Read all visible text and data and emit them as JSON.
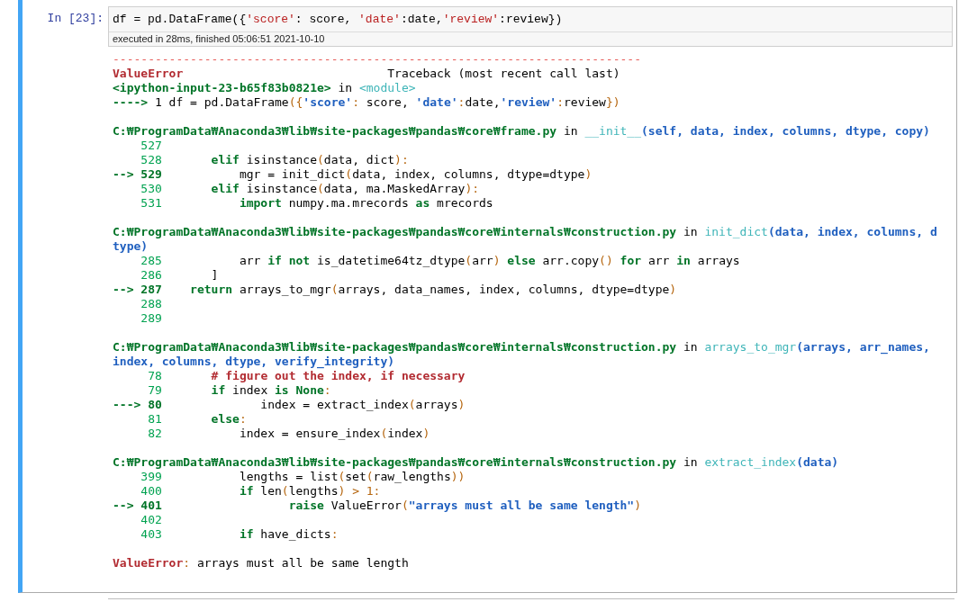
{
  "cell": {
    "prompt": "In [23]:",
    "selected": true,
    "input": [
      {
        "kind": "plain",
        "text": "df = pd.DataFrame({"
      },
      {
        "kind": "istr",
        "text": "'score'"
      },
      {
        "kind": "plain",
        "text": ": score, "
      },
      {
        "kind": "istr",
        "text": "'date'"
      },
      {
        "kind": "plain",
        "text": ":date,"
      },
      {
        "kind": "istr",
        "text": "'review'"
      },
      {
        "kind": "plain",
        "text": ":review})"
      }
    ],
    "execution_note": "executed in 28ms, finished 05:06:51 2021-10-10",
    "output": [
      {
        "lines": [
          [
            {
              "kind": "dash",
              "text": "---------------------------------------------------------------------------"
            }
          ],
          [
            {
              "kind": "error",
              "text": "ValueError"
            },
            {
              "kind": "plain",
              "text": "                             Traceback (most recent call last)"
            }
          ],
          [
            {
              "kind": "path",
              "text": "<ipython-input-23-b65f83b0821e>"
            },
            {
              "kind": "plain",
              "text": " in "
            },
            {
              "kind": "func",
              "text": "<module>"
            }
          ],
          [
            {
              "kind": "arrow",
              "text": "---->"
            },
            {
              "kind": "plain",
              "text": " 1 df = pd.DataFrame"
            },
            {
              "kind": "punct",
              "text": "({"
            },
            {
              "kind": "str",
              "text": "'score'"
            },
            {
              "kind": "punct",
              "text": ":"
            },
            {
              "kind": "plain",
              "text": " score, "
            },
            {
              "kind": "str",
              "text": "'date'"
            },
            {
              "kind": "punct",
              "text": ":"
            },
            {
              "kind": "plain",
              "text": "date,"
            },
            {
              "kind": "str",
              "text": "'review'"
            },
            {
              "kind": "punct",
              "text": ":"
            },
            {
              "kind": "plain",
              "text": "review"
            },
            {
              "kind": "punct",
              "text": "})"
            }
          ]
        ]
      },
      {
        "lines": [
          [
            {
              "kind": "path",
              "text": "C:₩ProgramData₩Anaconda3₩lib₩site-packages₩pandas₩core₩frame.py"
            },
            {
              "kind": "plain",
              "text": " in "
            },
            {
              "kind": "func",
              "text": "__init__"
            },
            {
              "kind": "args",
              "text": "(self, data, index, columns, dtype, copy)"
            }
          ],
          [
            {
              "kind": "lineno",
              "text": "    527"
            }
          ],
          [
            {
              "kind": "lineno",
              "text": "    528       "
            },
            {
              "kind": "kw",
              "text": "elif"
            },
            {
              "kind": "plain",
              "text": " isinstance"
            },
            {
              "kind": "punct",
              "text": "("
            },
            {
              "kind": "plain",
              "text": "data, dict"
            },
            {
              "kind": "punct",
              "text": "):"
            }
          ],
          [
            {
              "kind": "arrow",
              "text": "--> 529"
            },
            {
              "kind": "plain",
              "text": "           mgr = init_dict"
            },
            {
              "kind": "punct",
              "text": "("
            },
            {
              "kind": "plain",
              "text": "data, index, columns, dtype=dtype"
            },
            {
              "kind": "punct",
              "text": ")"
            }
          ],
          [
            {
              "kind": "lineno",
              "text": "    530       "
            },
            {
              "kind": "kw",
              "text": "elif"
            },
            {
              "kind": "plain",
              "text": " isinstance"
            },
            {
              "kind": "punct",
              "text": "("
            },
            {
              "kind": "plain",
              "text": "data, ma.MaskedArray"
            },
            {
              "kind": "punct",
              "text": "):"
            }
          ],
          [
            {
              "kind": "lineno",
              "text": "    531           "
            },
            {
              "kind": "kw",
              "text": "import"
            },
            {
              "kind": "plain",
              "text": " numpy.ma.mrecords "
            },
            {
              "kind": "kw",
              "text": "as"
            },
            {
              "kind": "plain",
              "text": " mrecords"
            }
          ]
        ]
      },
      {
        "lines": [
          [
            {
              "kind": "path",
              "text": "C:₩ProgramData₩Anaconda3₩lib₩site-packages₩pandas₩core₩internals₩construction.py"
            },
            {
              "kind": "plain",
              "text": " in "
            },
            {
              "kind": "func",
              "text": "init_dict"
            },
            {
              "kind": "args",
              "text": "(data, index, columns, dtype)"
            }
          ],
          [
            {
              "kind": "lineno",
              "text": "    285"
            },
            {
              "kind": "plain",
              "text": "           arr "
            },
            {
              "kind": "kw",
              "text": "if"
            },
            {
              "kind": "kw",
              "text": " not"
            },
            {
              "kind": "plain",
              "text": " is_datetime64tz_dtype"
            },
            {
              "kind": "punct",
              "text": "("
            },
            {
              "kind": "plain",
              "text": "arr"
            },
            {
              "kind": "punct",
              "text": ")"
            },
            {
              "kind": "kw",
              "text": " else"
            },
            {
              "kind": "plain",
              "text": " arr.copy"
            },
            {
              "kind": "punct",
              "text": "()"
            },
            {
              "kind": "kw",
              "text": " for"
            },
            {
              "kind": "plain",
              "text": " arr "
            },
            {
              "kind": "kw",
              "text": "in"
            },
            {
              "kind": "plain",
              "text": " arrays"
            }
          ],
          [
            {
              "kind": "lineno",
              "text": "    286"
            },
            {
              "kind": "plain",
              "text": "       ]"
            }
          ],
          [
            {
              "kind": "arrow",
              "text": "--> 287    "
            },
            {
              "kind": "kw",
              "text": "return"
            },
            {
              "kind": "plain",
              "text": " arrays_to_mgr"
            },
            {
              "kind": "punct",
              "text": "("
            },
            {
              "kind": "plain",
              "text": "arrays, data_names, index, columns, dtype=dtype"
            },
            {
              "kind": "punct",
              "text": ")"
            }
          ],
          [
            {
              "kind": "lineno",
              "text": "    288"
            }
          ],
          [
            {
              "kind": "lineno",
              "text": "    289"
            }
          ]
        ]
      },
      {
        "lines": [
          [
            {
              "kind": "path",
              "text": "C:₩ProgramData₩Anaconda3₩lib₩site-packages₩pandas₩core₩internals₩construction.py"
            },
            {
              "kind": "plain",
              "text": " in "
            },
            {
              "kind": "func",
              "text": "arrays_to_mgr"
            },
            {
              "kind": "args",
              "text": "(arrays, arr_names, index, columns, dtype, verify_integrity)"
            }
          ],
          [
            {
              "kind": "lineno",
              "text": "     78       "
            },
            {
              "kind": "comment",
              "text": "# figure out the index, if necessary"
            }
          ],
          [
            {
              "kind": "lineno",
              "text": "     79       "
            },
            {
              "kind": "kw",
              "text": "if"
            },
            {
              "kind": "plain",
              "text": " index "
            },
            {
              "kind": "kw",
              "text": "is"
            },
            {
              "kind": "kw",
              "text": " None"
            },
            {
              "kind": "punct",
              "text": ":"
            }
          ],
          [
            {
              "kind": "arrow",
              "text": "---> 80"
            },
            {
              "kind": "plain",
              "text": "              index = extract_index"
            },
            {
              "kind": "punct",
              "text": "("
            },
            {
              "kind": "plain",
              "text": "arrays"
            },
            {
              "kind": "punct",
              "text": ")"
            }
          ],
          [
            {
              "kind": "lineno",
              "text": "     81       "
            },
            {
              "kind": "kw",
              "text": "else"
            },
            {
              "kind": "punct",
              "text": ":"
            }
          ],
          [
            {
              "kind": "lineno",
              "text": "     82"
            },
            {
              "kind": "plain",
              "text": "           index = ensure_index"
            },
            {
              "kind": "punct",
              "text": "("
            },
            {
              "kind": "plain",
              "text": "index"
            },
            {
              "kind": "punct",
              "text": ")"
            }
          ]
        ]
      },
      {
        "lines": [
          [
            {
              "kind": "path",
              "text": "C:₩ProgramData₩Anaconda3₩lib₩site-packages₩pandas₩core₩internals₩construction.py"
            },
            {
              "kind": "plain",
              "text": " in "
            },
            {
              "kind": "func",
              "text": "extract_index"
            },
            {
              "kind": "args",
              "text": "(data)"
            }
          ],
          [
            {
              "kind": "lineno",
              "text": "    399"
            },
            {
              "kind": "plain",
              "text": "           lengths = list"
            },
            {
              "kind": "punct",
              "text": "("
            },
            {
              "kind": "plain",
              "text": "set"
            },
            {
              "kind": "punct",
              "text": "("
            },
            {
              "kind": "plain",
              "text": "raw_lengths"
            },
            {
              "kind": "punct",
              "text": "))"
            }
          ],
          [
            {
              "kind": "lineno",
              "text": "    400           "
            },
            {
              "kind": "kw",
              "text": "if"
            },
            {
              "kind": "plain",
              "text": " len"
            },
            {
              "kind": "punct",
              "text": "("
            },
            {
              "kind": "plain",
              "text": "lengths"
            },
            {
              "kind": "punct",
              "text": ")"
            },
            {
              "kind": "punct",
              "text": " > 1:"
            }
          ],
          [
            {
              "kind": "arrow",
              "text": "--> 401                  "
            },
            {
              "kind": "kw",
              "text": "raise"
            },
            {
              "kind": "plain",
              "text": " ValueError"
            },
            {
              "kind": "punct",
              "text": "("
            },
            {
              "kind": "str",
              "text": "\"arrays must all be same length\""
            },
            {
              "kind": "punct",
              "text": ")"
            }
          ],
          [
            {
              "kind": "lineno",
              "text": "    402"
            }
          ],
          [
            {
              "kind": "lineno",
              "text": "    403           "
            },
            {
              "kind": "kw",
              "text": "if"
            },
            {
              "kind": "plain",
              "text": " have_dicts"
            },
            {
              "kind": "punct",
              "text": ":"
            }
          ]
        ]
      },
      {
        "lines": [
          [
            {
              "kind": "error",
              "text": "ValueError"
            },
            {
              "kind": "punct",
              "text": ":"
            },
            {
              "kind": "plain",
              "text": " arrays must all be same length"
            }
          ]
        ]
      }
    ]
  }
}
